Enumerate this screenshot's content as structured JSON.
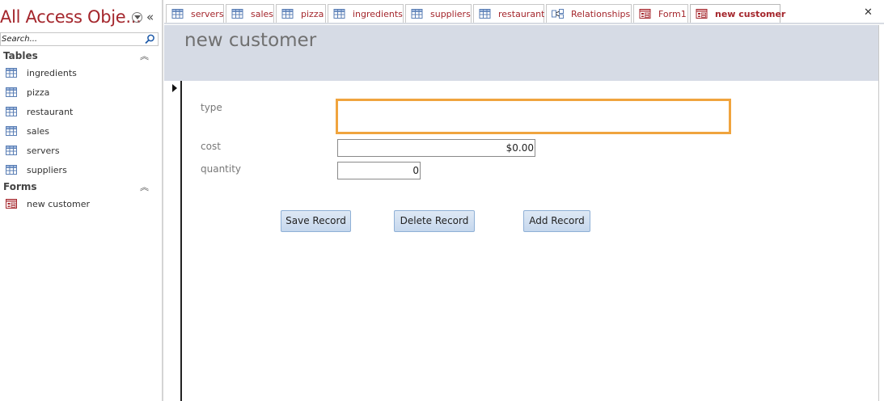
{
  "nav": {
    "title": "All Access Obje...",
    "search_placeholder": "Search...",
    "groups": [
      {
        "label": "Tables",
        "items": [
          "ingredients",
          "pizza",
          "restaurant",
          "sales",
          "servers",
          "suppliers"
        ]
      },
      {
        "label": "Forms",
        "items": [
          "new customer"
        ]
      }
    ]
  },
  "tabs": [
    {
      "label": "servers",
      "icon": "table-icon"
    },
    {
      "label": "sales",
      "icon": "table-icon"
    },
    {
      "label": "pizza",
      "icon": "table-icon"
    },
    {
      "label": "ingredients",
      "icon": "table-icon"
    },
    {
      "label": "suppliers",
      "icon": "table-icon"
    },
    {
      "label": "restaurant",
      "icon": "table-icon"
    },
    {
      "label": "Relationships",
      "icon": "relationships-icon"
    },
    {
      "label": "Form1",
      "icon": "form-icon"
    },
    {
      "label": "new customer",
      "icon": "form-icon",
      "active": true
    }
  ],
  "form": {
    "title": "new customer",
    "fields": {
      "type": {
        "label": "type",
        "value": ""
      },
      "cost": {
        "label": "cost",
        "value": "$0.00"
      },
      "quantity": {
        "label": "quantity",
        "value": "0"
      }
    },
    "buttons": {
      "save": "Save Record",
      "delete": "Delete Record",
      "add": "Add Record"
    }
  },
  "colors": {
    "accent": "#a4262c",
    "focus": "#f0a43e",
    "header_band": "#d6dbe5"
  }
}
